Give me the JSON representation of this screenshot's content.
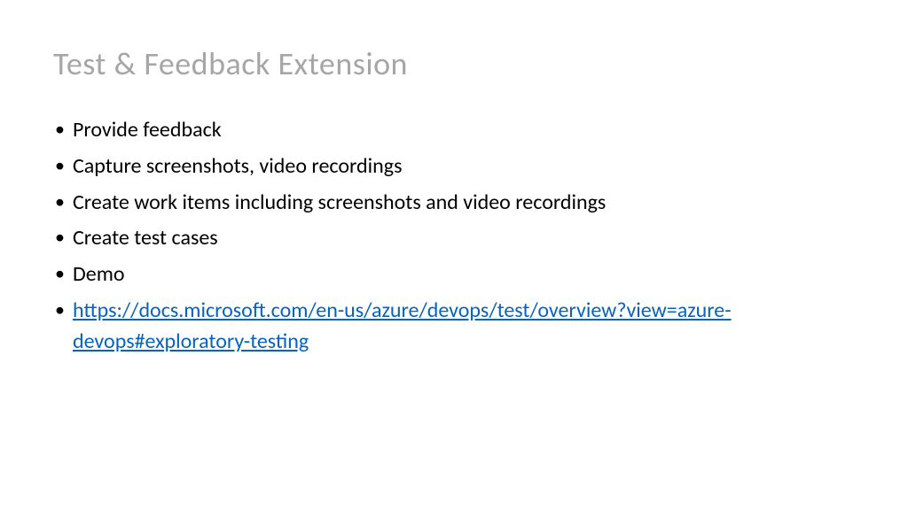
{
  "slide": {
    "title": "Test & Feedback Extension",
    "bullets": [
      "Provide feedback",
      "Capture screenshots, video recordings",
      "Create work items including screenshots and video recordings",
      "Create test cases",
      "Demo"
    ],
    "link": "https://docs.microsoft.com/en-us/azure/devops/test/overview?view=azure-devops#exploratory-testing"
  }
}
